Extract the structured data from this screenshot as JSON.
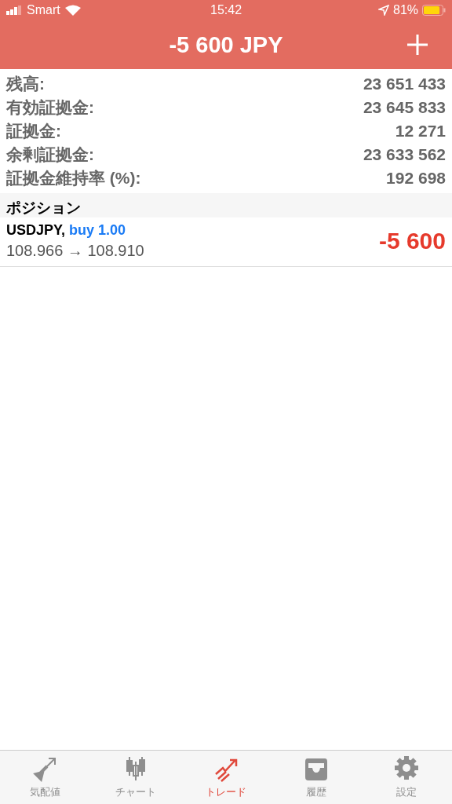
{
  "status_bar": {
    "carrier": "Smart",
    "time": "15:42",
    "battery": "81%"
  },
  "header": {
    "title": "-5 600 JPY"
  },
  "summary": [
    {
      "label": "残高:",
      "value": "23 651 433"
    },
    {
      "label": "有効証拠金:",
      "value": "23 645 833"
    },
    {
      "label": "証拠金:",
      "value": "12 271"
    },
    {
      "label": "余剰証拠金:",
      "value": "23 633 562"
    },
    {
      "label": "証拠金維持率 (%):",
      "value": "192 698"
    }
  ],
  "positions": {
    "heading": "ポジション",
    "items": [
      {
        "symbol": "USDJPY,",
        "side": "buy 1.00",
        "prices": "108.966 → 108.910",
        "profit": "-5 600"
      }
    ]
  },
  "tabs": [
    {
      "kind": "quotes",
      "label": "気配値",
      "selected": false
    },
    {
      "kind": "chart",
      "label": "チャート",
      "selected": false
    },
    {
      "kind": "trade",
      "label": "トレード",
      "selected": true
    },
    {
      "kind": "history",
      "label": "履歴",
      "selected": false
    },
    {
      "kind": "settings",
      "label": "設定",
      "selected": false
    }
  ]
}
